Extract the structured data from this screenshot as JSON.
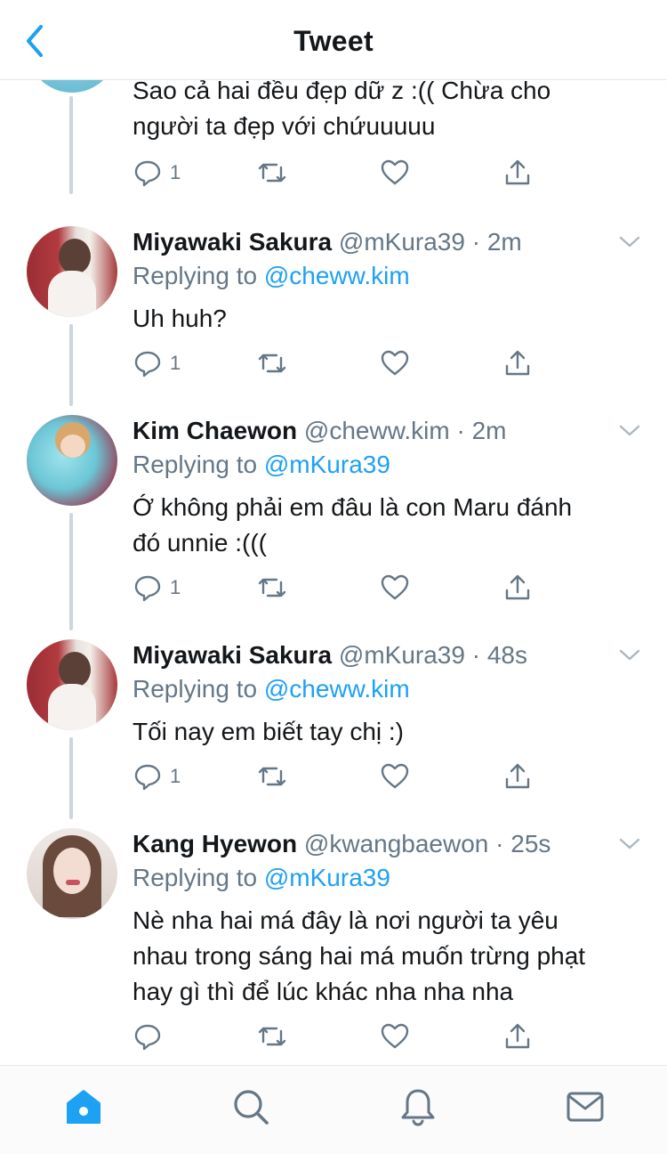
{
  "header": {
    "title": "Tweet",
    "back_icon": "chevron-left-icon"
  },
  "colors": {
    "accent": "#1da1f2",
    "secondary_text": "#657786",
    "thread_line": "#ccd6dd"
  },
  "tweets": [
    {
      "text_lines": [
        "Sao cả hai đều đẹp dữ z :(( Chừa cho",
        "người ta đẹp với chứuuuuu"
      ],
      "reply_count": "1"
    },
    {
      "name": "Miyawaki Sakura",
      "handle": "@mKura39",
      "dot": "·",
      "time": "2m",
      "replying_prefix": "Replying to",
      "replying_to": "@cheww.kim",
      "text_lines": [
        "Uh huh?"
      ],
      "reply_count": "1"
    },
    {
      "name": "Kim Chaewon",
      "handle": "@cheww.kim",
      "dot": "·",
      "time": "2m",
      "replying_prefix": "Replying to",
      "replying_to": "@mKura39",
      "text_lines": [
        "Ớ không phải em đâu là con Maru đánh",
        "đó unnie :((("
      ],
      "reply_count": "1"
    },
    {
      "name": "Miyawaki Sakura",
      "handle": "@mKura39",
      "dot": "·",
      "time": "48s",
      "replying_prefix": "Replying to",
      "replying_to": "@cheww.kim",
      "text_lines": [
        "Tối nay em biết tay chị :)"
      ],
      "reply_count": "1"
    },
    {
      "name": "Kang Hyewon",
      "handle": "@kwangbaewon",
      "dot": "·",
      "time": "25s",
      "replying_prefix": "Replying to",
      "replying_to": "@mKura39",
      "text_lines": [
        "Nè nha hai má đây là nơi người ta yêu",
        "nhau trong sáng hai má muốn trừng phạt",
        "hay gì thì để lúc khác nha nha nha"
      ],
      "reply_count": ""
    }
  ],
  "action_icons": [
    "reply-icon",
    "retweet-icon",
    "like-icon",
    "share-icon"
  ],
  "tabbar": {
    "items": [
      "home-icon",
      "search-icon",
      "notifications-icon",
      "messages-icon"
    ],
    "active": "home-icon"
  }
}
